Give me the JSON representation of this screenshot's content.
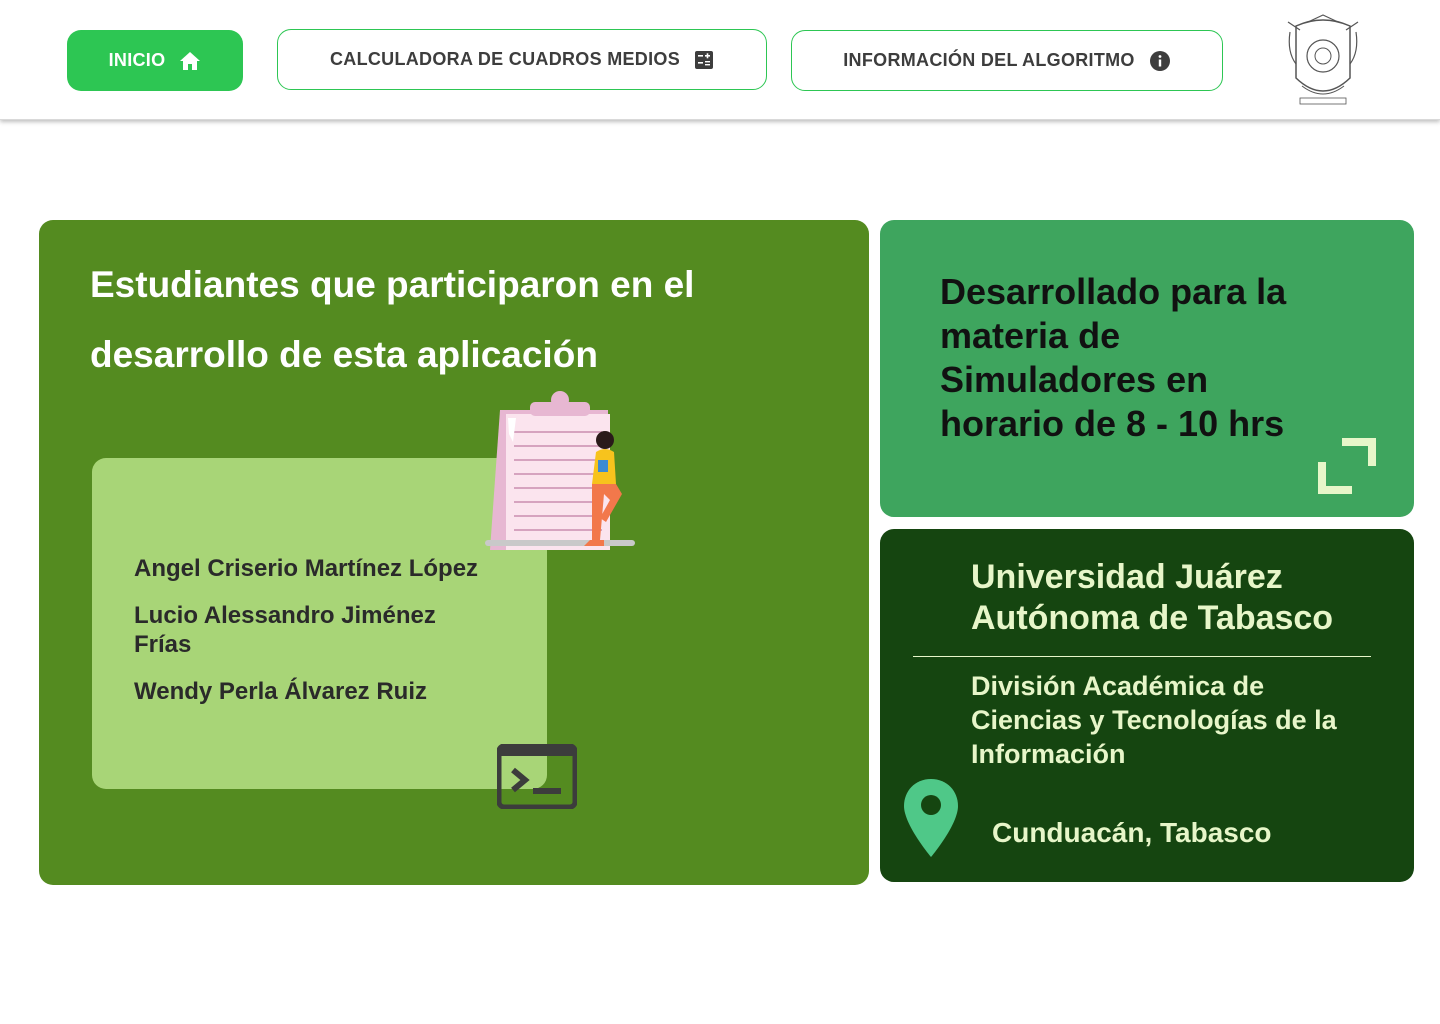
{
  "header": {
    "nav": {
      "inicio_label": "INICIO",
      "calculadora_label": "CALCULADORA DE CUADROS MEDIOS",
      "informacion_label": "INFORMACIÓN DEL ALGORITMO"
    },
    "icons": [
      "home-icon",
      "calculator-icon",
      "info-icon",
      "university-seal"
    ]
  },
  "students_card": {
    "title": "Estudiantes que participaron en el desarrollo de esta aplicación",
    "names": [
      "Angel Criserio Martínez López",
      "Lucio Alessandro Jiménez Frías",
      "Wendy Perla Álvarez Ruiz"
    ],
    "icons": [
      "clipboard-person-illustration",
      "terminal-icon"
    ]
  },
  "course_card": {
    "text": "Desarrollado para la materia de Simuladores en horario de 8 - 10 hrs",
    "icons": [
      "expand-icon"
    ]
  },
  "university_card": {
    "university": "Universidad Juárez Autónoma de Tabasco",
    "division": "División Académica de Ciencias y Tecnologías de la Información",
    "location": "Cunduacán, Tabasco",
    "icons": [
      "location-pin-icon"
    ]
  },
  "colors": {
    "primary_green": "#2dc653",
    "card_left": "#548b20",
    "names_box": "#a8d577",
    "card_right_top": "#3ea55e",
    "card_right_bottom": "#154510",
    "light_text": "#e7f6c9"
  }
}
